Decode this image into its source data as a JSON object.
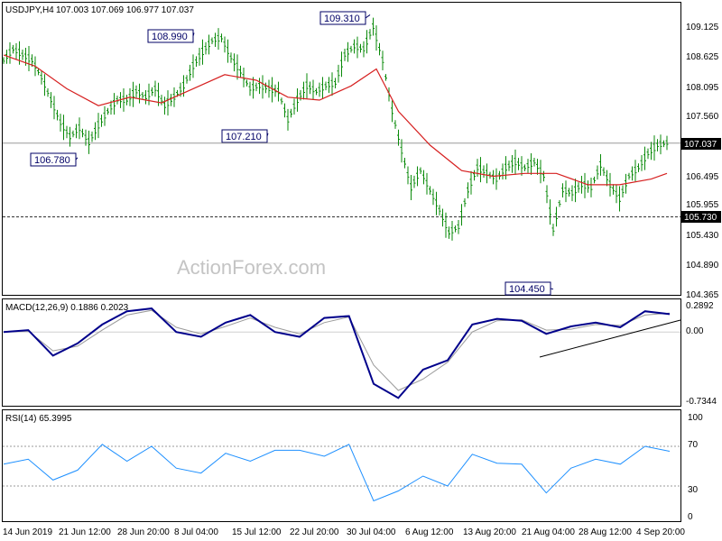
{
  "header": {
    "symbol": "USDJPY,H4",
    "ohlc": "107.003 107.069 106.977 107.037",
    "macd_label": "MACD(12,26,9) 0.1886 0.2023",
    "rsi_label": "RSI(14) 65.3995"
  },
  "watermark": "ActionForex.com",
  "price_axis": [
    "109.125",
    "108.625",
    "108.095",
    "107.560",
    "106.495",
    "105.955",
    "105.430",
    "104.890",
    "104.365"
  ],
  "price_axis_values": [
    109.125,
    108.625,
    108.095,
    107.56,
    106.495,
    105.955,
    105.43,
    104.89,
    104.365
  ],
  "current_price": {
    "label": "107.037",
    "value": 107.037
  },
  "support_level": {
    "label": "105.730",
    "value": 105.73
  },
  "callouts": [
    {
      "label": "109.310",
      "value": 109.31
    },
    {
      "label": "108.990",
      "value": 108.99
    },
    {
      "label": "107.210",
      "value": 107.21
    },
    {
      "label": "106.780",
      "value": 106.78
    },
    {
      "label": "104.450",
      "value": 104.45
    }
  ],
  "macd_axis": [
    "0.2892",
    "0.00",
    "-0.7344"
  ],
  "rsi_axis": [
    "100",
    "70",
    "30",
    "0"
  ],
  "time_axis": [
    "14 Jun 2019",
    "21 Jun 12:00",
    "28 Jun 20:00",
    "8 Jul 04:00",
    "15 Jul 12:00",
    "22 Jul 20:00",
    "30 Jul 04:00",
    "6 Aug 12:00",
    "13 Aug 20:00",
    "21 Aug 04:00",
    "28 Aug 12:00",
    "4 Sep 20:00"
  ],
  "colors": {
    "ma": "#d62020",
    "macd": "#00008b",
    "signal": "#9a9a9a",
    "rsi": "#1e90ff",
    "trendline": "#cc0000",
    "bars": "#0a8a0a",
    "callout": "#000066",
    "label_box": "#000000"
  },
  "chart_data": [
    {
      "type": "line",
      "title": "USDJPY,H4",
      "subtitle": "107.003 107.069 106.977 107.037",
      "ylim": [
        104.365,
        109.45
      ],
      "x": [
        "14 Jun 2019",
        "21 Jun 12:00",
        "28 Jun 20:00",
        "8 Jul 04:00",
        "15 Jul 12:00",
        "22 Jul 20:00",
        "30 Jul 04:00",
        "6 Aug 12:00",
        "13 Aug 20:00",
        "21 Aug 04:00",
        "28 Aug 12:00",
        "4 Sep 20:00"
      ],
      "series": [
        {
          "values": [
            108.55,
            107.25,
            107.8,
            108.75,
            107.55,
            108.25,
            109.0,
            106.1,
            106.45,
            105.85,
            106.35,
            107.0
          ]
        },
        {
          "values": [
            108.6,
            108.0,
            107.85,
            108.3,
            108.0,
            108.0,
            108.5,
            107.2,
            106.5,
            106.45,
            106.3,
            106.6
          ]
        }
      ],
      "price_bars": [
        [
          0,
          108.5
        ],
        [
          3,
          108.7
        ],
        [
          6,
          108.6
        ],
        [
          9,
          108.5
        ],
        [
          12,
          108.2
        ],
        [
          15,
          107.8
        ],
        [
          18,
          107.4
        ],
        [
          21,
          107.15
        ],
        [
          24,
          107.3
        ],
        [
          27,
          107.05
        ],
        [
          30,
          107.35
        ],
        [
          33,
          107.6
        ],
        [
          36,
          107.8
        ],
        [
          39,
          107.8
        ],
        [
          42,
          107.95
        ],
        [
          45,
          107.85
        ],
        [
          48,
          108.0
        ],
        [
          51,
          107.7
        ],
        [
          54,
          107.85
        ],
        [
          57,
          108.05
        ],
        [
          60,
          108.4
        ],
        [
          63,
          108.65
        ],
        [
          66,
          108.85
        ],
        [
          69,
          108.9
        ],
        [
          72,
          108.55
        ],
        [
          75,
          108.3
        ],
        [
          78,
          108.0
        ],
        [
          81,
          108.05
        ],
        [
          84,
          108.0
        ],
        [
          87,
          107.95
        ],
        [
          90,
          107.45
        ],
        [
          93,
          107.8
        ],
        [
          96,
          108.05
        ],
        [
          99,
          107.95
        ],
        [
          102,
          108.05
        ],
        [
          105,
          108.1
        ],
        [
          108,
          108.6
        ],
        [
          111,
          108.75
        ],
        [
          114,
          108.7
        ],
        [
          117,
          109.1
        ],
        [
          120,
          108.5
        ],
        [
          123,
          107.6
        ],
        [
          126,
          106.9
        ],
        [
          129,
          106.25
        ],
        [
          132,
          106.55
        ],
        [
          135,
          106.2
        ],
        [
          138,
          105.85
        ],
        [
          141,
          105.45
        ],
        [
          144,
          105.55
        ],
        [
          147,
          106.2
        ],
        [
          150,
          106.6
        ],
        [
          153,
          106.5
        ],
        [
          156,
          106.4
        ],
        [
          159,
          106.6
        ],
        [
          162,
          106.7
        ],
        [
          165,
          106.6
        ],
        [
          168,
          106.7
        ],
        [
          171,
          106.45
        ],
        [
          174,
          105.5
        ],
        [
          177,
          106.2
        ],
        [
          180,
          106.15
        ],
        [
          183,
          106.3
        ],
        [
          186,
          106.25
        ],
        [
          189,
          106.65
        ],
        [
          192,
          106.3
        ],
        [
          195,
          106.05
        ],
        [
          198,
          106.45
        ],
        [
          201,
          106.6
        ],
        [
          204,
          106.85
        ],
        [
          207,
          107.0
        ],
        [
          210,
          107.04
        ]
      ],
      "moving_average": [
        [
          0,
          108.6
        ],
        [
          10,
          108.4
        ],
        [
          20,
          108.0
        ],
        [
          30,
          107.7
        ],
        [
          40,
          107.85
        ],
        [
          50,
          107.75
        ],
        [
          60,
          108.0
        ],
        [
          70,
          108.25
        ],
        [
          80,
          108.15
        ],
        [
          90,
          107.85
        ],
        [
          100,
          107.8
        ],
        [
          110,
          108.05
        ],
        [
          118,
          108.35
        ],
        [
          125,
          107.6
        ],
        [
          135,
          107.0
        ],
        [
          145,
          106.55
        ],
        [
          155,
          106.45
        ],
        [
          165,
          106.5
        ],
        [
          175,
          106.5
        ],
        [
          185,
          106.3
        ],
        [
          195,
          106.3
        ],
        [
          205,
          106.4
        ],
        [
          210,
          106.5
        ]
      ]
    },
    {
      "type": "line",
      "title": "MACD(12,26,9) 0.1886 0.2023",
      "ylim": [
        -0.7344,
        0.2892
      ],
      "series": [
        {
          "values": [
            0.0,
            0.02,
            -0.25,
            -0.12,
            0.08,
            0.22,
            0.25,
            0.0,
            -0.05,
            0.1,
            0.18,
            0.0,
            -0.05,
            0.15,
            0.17,
            -0.55,
            -0.7,
            -0.4,
            -0.3,
            0.08,
            0.14,
            0.12,
            -0.02,
            0.06,
            0.1,
            0.05,
            0.22,
            0.19
          ]
        },
        {
          "values": [
            0.0,
            0.01,
            -0.2,
            -0.15,
            0.02,
            0.18,
            0.23,
            0.05,
            -0.02,
            0.06,
            0.15,
            0.05,
            -0.02,
            0.1,
            0.16,
            -0.35,
            -0.62,
            -0.5,
            -0.32,
            0.0,
            0.12,
            0.13,
            0.02,
            0.03,
            0.08,
            0.07,
            0.18,
            0.2
          ]
        }
      ],
      "zero_line": 0.0
    },
    {
      "type": "line",
      "title": "RSI(14) 65.3995",
      "ylim": [
        0,
        100
      ],
      "series": [
        {
          "values": [
            52,
            57,
            36,
            46,
            72,
            55,
            70,
            48,
            43,
            63,
            55,
            66,
            66,
            60,
            72,
            15,
            25,
            40,
            30,
            62,
            53,
            52,
            23,
            48,
            57,
            52,
            70,
            65
          ]
        }
      ],
      "levels": [
        70,
        30
      ]
    }
  ]
}
